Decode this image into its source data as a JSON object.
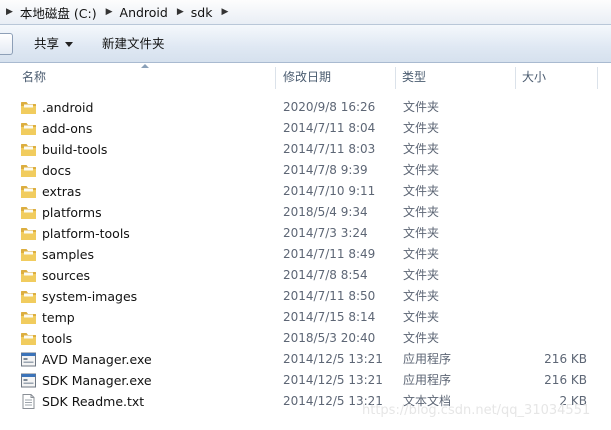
{
  "breadcrumb": [
    "本地磁盘 (C:)",
    "Android",
    "sdk"
  ],
  "toolbar": {
    "share_label": "共享",
    "new_folder_label": "新建文件夹"
  },
  "columns": {
    "name": "名称",
    "date": "修改日期",
    "type": "类型",
    "size": "大小"
  },
  "files": [
    {
      "name": ".android",
      "date": "2020/9/8 16:26",
      "type": "文件夹",
      "size": "",
      "icon": "folder-icon"
    },
    {
      "name": "add-ons",
      "date": "2014/7/11 8:04",
      "type": "文件夹",
      "size": "",
      "icon": "folder-icon"
    },
    {
      "name": "build-tools",
      "date": "2014/7/11 8:03",
      "type": "文件夹",
      "size": "",
      "icon": "folder-icon"
    },
    {
      "name": "docs",
      "date": "2014/7/8 9:39",
      "type": "文件夹",
      "size": "",
      "icon": "folder-icon"
    },
    {
      "name": "extras",
      "date": "2014/7/10 9:11",
      "type": "文件夹",
      "size": "",
      "icon": "folder-icon"
    },
    {
      "name": "platforms",
      "date": "2018/5/4 9:34",
      "type": "文件夹",
      "size": "",
      "icon": "folder-icon"
    },
    {
      "name": "platform-tools",
      "date": "2014/7/3 3:24",
      "type": "文件夹",
      "size": "",
      "icon": "folder-icon"
    },
    {
      "name": "samples",
      "date": "2014/7/11 8:49",
      "type": "文件夹",
      "size": "",
      "icon": "folder-icon"
    },
    {
      "name": "sources",
      "date": "2014/7/8 8:54",
      "type": "文件夹",
      "size": "",
      "icon": "folder-icon"
    },
    {
      "name": "system-images",
      "date": "2014/7/11 8:50",
      "type": "文件夹",
      "size": "",
      "icon": "folder-icon"
    },
    {
      "name": "temp",
      "date": "2014/7/15 8:14",
      "type": "文件夹",
      "size": "",
      "icon": "folder-icon"
    },
    {
      "name": "tools",
      "date": "2018/5/3 20:40",
      "type": "文件夹",
      "size": "",
      "icon": "folder-icon"
    },
    {
      "name": "AVD Manager.exe",
      "date": "2014/12/5 13:21",
      "type": "应用程序",
      "size": "216 KB",
      "icon": "exe-icon"
    },
    {
      "name": "SDK Manager.exe",
      "date": "2014/12/5 13:21",
      "type": "应用程序",
      "size": "216 KB",
      "icon": "exe-icon"
    },
    {
      "name": "SDK Readme.txt",
      "date": "2014/12/5 13:21",
      "type": "文本文档",
      "size": "2 KB",
      "icon": "text-file-icon"
    }
  ],
  "watermark": "https://blog.csdn.net/qq_31034551"
}
